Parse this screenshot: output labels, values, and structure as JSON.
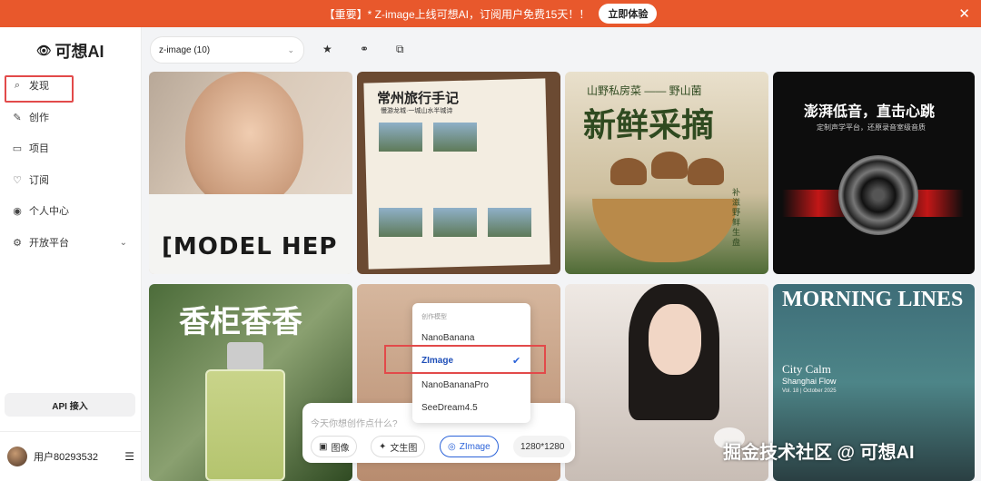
{
  "banner": {
    "text": "【重要】* Z-image上线可想AI，订阅用户免费15天！！",
    "button": "立即体验",
    "close": "✕"
  },
  "sidebar": {
    "logo_mark": "👁",
    "logo": "可想AI",
    "items": [
      {
        "label": "发现",
        "icon": "⌕"
      },
      {
        "label": "创作",
        "icon": "✎"
      },
      {
        "label": "项目",
        "icon": "▭"
      },
      {
        "label": "订阅",
        "icon": "♡"
      },
      {
        "label": "个人中心",
        "icon": "◉"
      },
      {
        "label": "开放平台",
        "icon": "⚙"
      }
    ],
    "api_button": "API 接入",
    "user": {
      "name": "用户80293532",
      "menu": "☰"
    }
  },
  "toolbar": {
    "select_value": "z-image (10)",
    "star": "★",
    "share": "⚭",
    "folder": "⧉"
  },
  "cards": {
    "c1": {
      "text": "[MODEL HEP"
    },
    "c2": {
      "title": "常州旅行手记",
      "subtitle": "慢游龙城·一城山水半城诗"
    },
    "c3": {
      "top": "山野私房菜 —— 野山菌",
      "title": "新鲜采摘",
      "side": "补滋野鲜生盘"
    },
    "c4": {
      "title": "澎湃低音，直击心跳",
      "subtitle": "定制声学平台，还原录音室级音质"
    },
    "c5": {
      "title": "香柜香香"
    },
    "c8": {
      "title": "MORNING LINES",
      "sub1": "City Calm",
      "sub2": "Shanghai Flow",
      "sub3": "Vol. 18 | October 2025"
    }
  },
  "dropdown": {
    "title": "创作模型",
    "options": [
      "NanoBanana",
      "ZImage",
      "NanoBananaPro",
      "SeeDream4.5"
    ],
    "selected_check": "✔"
  },
  "prompt": {
    "placeholder": "今天你想创作点什么?",
    "chips": {
      "image": "图像",
      "text2img": "文生图",
      "model": "ZImage",
      "size": "1280*1280"
    }
  },
  "watermark": "掘金技术社区 @ 可想AI"
}
